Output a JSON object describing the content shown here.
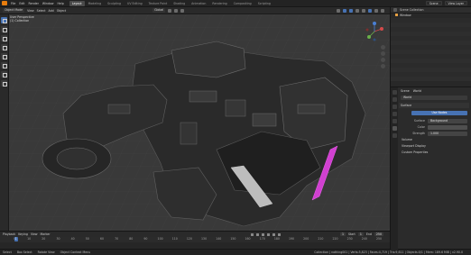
{
  "topbar": {
    "menus": [
      "File",
      "Edit",
      "Render",
      "Window",
      "Help"
    ],
    "workspaces": [
      "Layout",
      "Modeling",
      "Sculpting",
      "UV Editing",
      "Texture Paint",
      "Shading",
      "Animation",
      "Rendering",
      "Compositing",
      "Scripting"
    ],
    "active_workspace": "Layout",
    "scene": "Scene",
    "view_layer": "View Layer"
  },
  "toolbar": {
    "mode": "Object Mode",
    "menus": [
      "View",
      "Select",
      "Add",
      "Object"
    ],
    "orientation": "Global"
  },
  "viewport": {
    "view_name": "User Perspective",
    "collection": "(1) Collection"
  },
  "timeline": {
    "menus": [
      "Playback",
      "Keying",
      "View",
      "Marker"
    ],
    "current_frame": "1",
    "start_label": "Start",
    "start": "1",
    "end_label": "End",
    "end": "250",
    "ticks": [
      "0",
      "10",
      "20",
      "30",
      "40",
      "50",
      "60",
      "70",
      "80",
      "90",
      "100",
      "110",
      "120",
      "130",
      "140",
      "150",
      "160",
      "170",
      "180",
      "190",
      "200",
      "210",
      "220",
      "230",
      "240",
      "250"
    ]
  },
  "statusbar": {
    "select": "Select",
    "box_select": "Box Select",
    "rotate": "Rotate View",
    "context": "Object Context Menu",
    "stats": "Collection | nothing001 | Verts:5,823 | Faces:4,719 | Tris:9,611 | Objects:0/1 | Mem: 189.6 MiB | v2.90.0"
  },
  "outliner": {
    "title": "Scene Collection",
    "row": "Window"
  },
  "properties": {
    "header_left": "Scene",
    "header_right": "World",
    "world_name": "World",
    "surface_panel": "Surface",
    "use_nodes": "Use Nodes",
    "surface_key": "Surface",
    "surface_value": "Background",
    "color_key": "Color",
    "strength_key": "Strength",
    "strength_value": "1.000",
    "volume_panel": "Volume",
    "viewport_display": "Viewport Display",
    "custom_properties": "Custom Properties"
  },
  "colors": {
    "accent": "#4772b3",
    "magenta_highlight": "#d040d0",
    "orange_logo": "#e87d0d"
  }
}
